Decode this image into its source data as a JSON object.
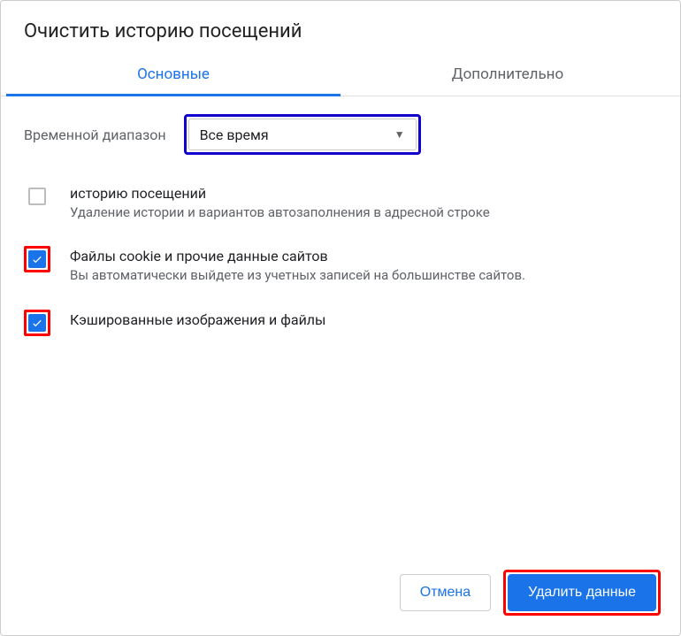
{
  "dialog": {
    "title": "Очистить историю посещений"
  },
  "tabs": {
    "basic": "Основные",
    "advanced": "Дополнительно"
  },
  "timeRange": {
    "label": "Временной диапазон",
    "value": "Все время"
  },
  "options": {
    "history": {
      "checked": false,
      "title": "историю посещений",
      "desc": "Удаление истории и вариантов автозаполнения в адресной строке"
    },
    "cookies": {
      "checked": true,
      "title": "Файлы cookie и прочие данные сайтов",
      "desc": "Вы автоматически выйдете из учетных записей на большинстве сайтов."
    },
    "cache": {
      "checked": true,
      "title": "Кэшированные изображения и файлы",
      "desc": ""
    }
  },
  "buttons": {
    "cancel": "Отмена",
    "confirm": "Удалить данные"
  }
}
